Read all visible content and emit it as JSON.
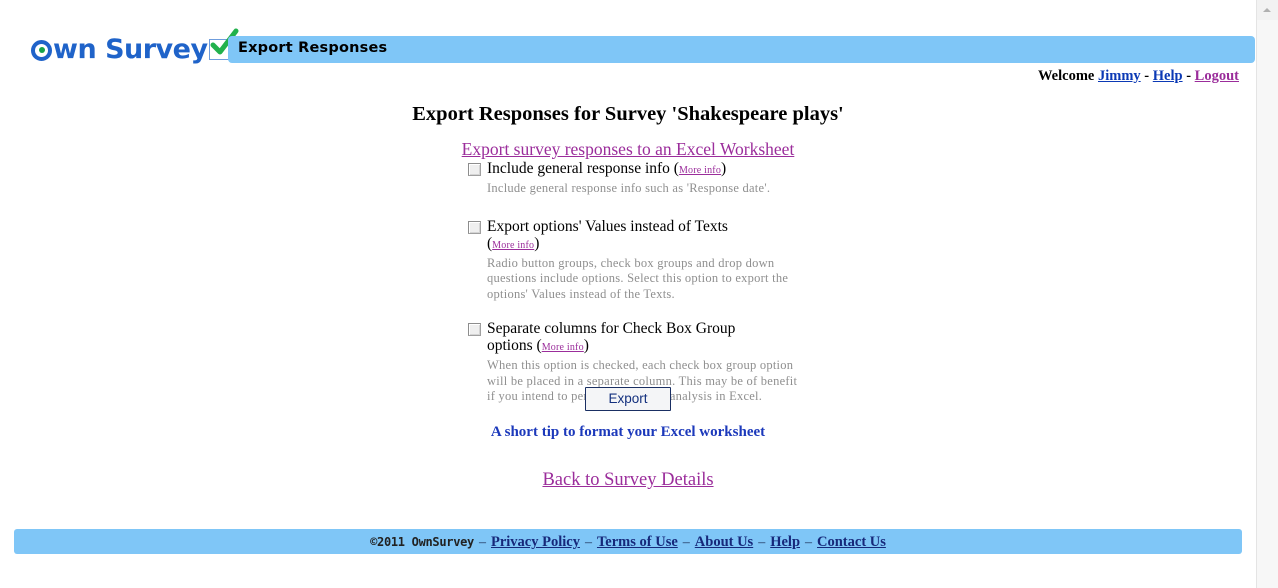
{
  "brand": {
    "logo_text_before": "",
    "logo_word_one": "wn",
    "logo_word_two": "Survey",
    "logo_icon_radio": "radio-dot-icon",
    "logo_icon_check": "green-checkmark-icon"
  },
  "header": {
    "title_bar": "Export Responses",
    "welcome_prefix": "Welcome",
    "user_name": "Jimmy",
    "separator": "-",
    "help_label": "Help",
    "logout_label": "Logout"
  },
  "main": {
    "page_title": "Export Responses for Survey 'Shakespeare plays'",
    "excel_link": "Export survey responses to an Excel Worksheet",
    "more_info_label": "More info",
    "paren_open": "(",
    "paren_close": ")",
    "options": [
      {
        "label": "Include general response info",
        "has_more_info_inline": true,
        "label_line2": "",
        "description": "Include general response info such as 'Response date'."
      },
      {
        "label": "Export options' Values instead of Texts",
        "has_more_info_inline": false,
        "label_line2": "",
        "description": "Radio button groups, check box groups and drop down questions include options. Select this option to export the options' Values instead of the Texts."
      },
      {
        "label": "Separate columns for Check Box Group",
        "has_more_info_inline": false,
        "label_line2": "options",
        "description": "When this option is checked, each check box group option will be placed in a separate column. This may be of benefit if you intend to perform statistical analysis in Excel."
      }
    ],
    "export_button": "Export",
    "tip_link": "A short tip to format your Excel worksheet",
    "back_link": "Back to Survey Details"
  },
  "footer": {
    "copyright": "©2011 OwnSurvey",
    "separator": "–",
    "links": [
      "Privacy Policy",
      "Terms of Use",
      "About Us",
      "Help",
      "Contact Us"
    ]
  },
  "colors": {
    "bar_blue": "#7fc6f7",
    "link_purple": "#9b2d9b",
    "link_blue": "#0b39b5",
    "brand_blue": "#1f63c9",
    "brand_green": "#16a34a",
    "desc_grey": "#8f8f8f"
  },
  "scrollbar": {
    "up_arrow": "scroll-up-arrow-icon"
  }
}
